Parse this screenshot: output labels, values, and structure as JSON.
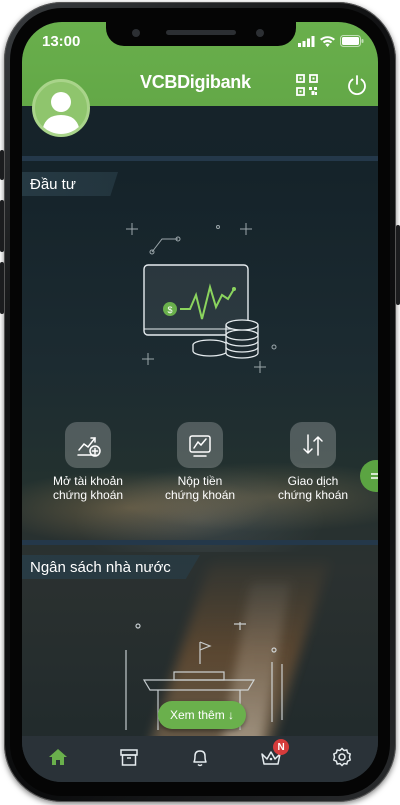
{
  "status_bar": {
    "time": "13:00"
  },
  "header": {
    "brand": "VCB Digibank",
    "brand_bold": "VCB",
    "brand_rest": "Digibank"
  },
  "colors": {
    "brand_green": "#6ab04c",
    "tabbar": "#2a3238",
    "badge_red": "#d63b3b"
  },
  "investment": {
    "title": "Đầu tư",
    "illustration": "stock-chart-coins-illustration",
    "actions": [
      {
        "line1": "Mở tài khoản",
        "line2": "chứng khoán",
        "icon": "open-account-chart-icon"
      },
      {
        "line1": "Nộp tiền",
        "line2": "chứng khoán",
        "icon": "deposit-chart-icon"
      },
      {
        "line1": "Giao dịch",
        "line2": "chứng khoán",
        "icon": "exchange-arrows-icon"
      }
    ]
  },
  "budget": {
    "title": "Ngân sách nhà nước",
    "illustration": "state-building-illustration"
  },
  "see_more": "Xem thêm ↓",
  "tabbar": {
    "items": [
      {
        "name": "home",
        "icon": "home-icon",
        "active": true
      },
      {
        "name": "products",
        "icon": "box-icon"
      },
      {
        "name": "notifications",
        "icon": "bell-icon"
      },
      {
        "name": "rewards",
        "icon": "crown-icon",
        "badge": "N"
      },
      {
        "name": "settings",
        "icon": "gear-icon"
      }
    ]
  }
}
